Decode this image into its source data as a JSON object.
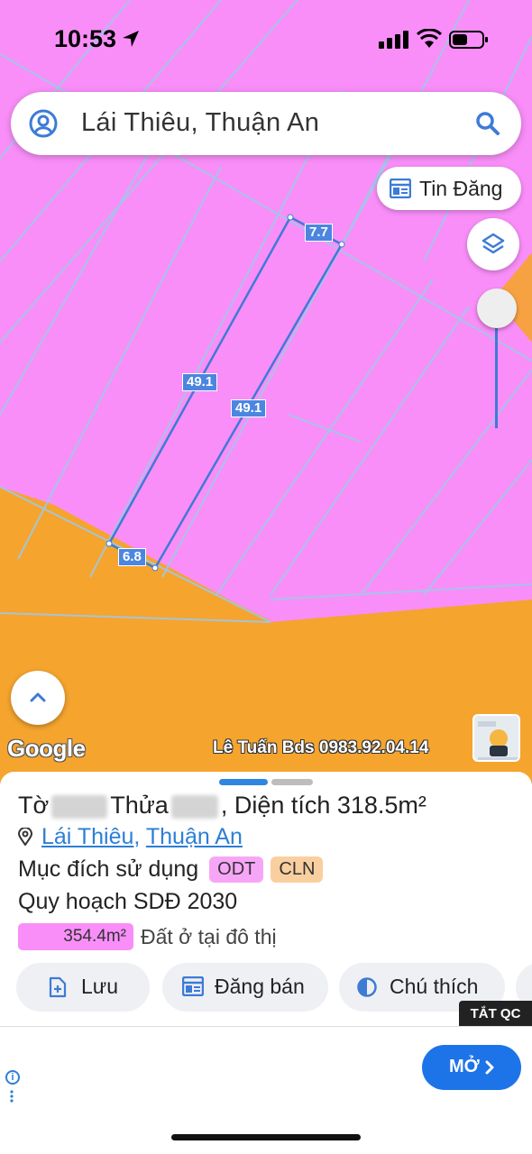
{
  "status_bar": {
    "time": "10:53"
  },
  "search": {
    "query": "Lái Thiêu, Thuận An"
  },
  "map": {
    "tin_dang_label": "Tin Đăng",
    "measurements": {
      "top": "7.7",
      "left": "49.1",
      "right": "49.1",
      "bottom": "6.8"
    },
    "google_label": "Google",
    "watermark": "Lê Tuấn Bds 0983.92.04.14",
    "colors": {
      "land_odt": "#f98ef9",
      "land_cln": "#f5a42e",
      "parcel_outline": "#3d7bd6"
    }
  },
  "sheet": {
    "title_prefix": "Tờ",
    "title_mid": "Thửa",
    "title_area": ", Diện tích 318.5m²",
    "ward": "Lái Thiêu",
    "addr_sep": ",",
    "district": "Thuận An",
    "purpose_label": "Mục đích sử dụng",
    "tag_odt": "ODT",
    "tag_cln": "CLN",
    "plan_label": "Quy hoạch SDĐ 2030",
    "legend_area": "354.4m²",
    "legend_text": "Đất ở tại đô thị",
    "actions": {
      "save": "Lưu",
      "post_sale": "Đăng bán",
      "legend": "Chú thích"
    }
  },
  "ad": {
    "close_label": "TẮT QC",
    "open_label": "MỞ"
  }
}
